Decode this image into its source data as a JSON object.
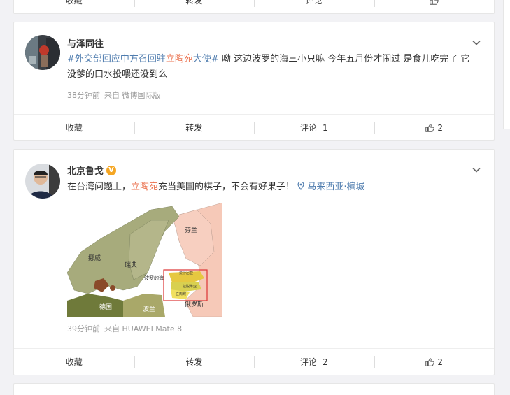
{
  "top_actions": {
    "collect": "收藏",
    "repost": "转发",
    "comment": "评论"
  },
  "post1": {
    "username": "与泽同往",
    "text_topic1": "#外交部回应中方召回驻",
    "text_mention": "立陶宛",
    "text_topic2": "大使#",
    "text_body": " 呦 这边波罗的海三小只嘛 今年五月份才闹过 是食儿吃完了 它没爹的口水投喂还没到么",
    "time": "38分钟前",
    "source": "来自 微博国际版",
    "actions": {
      "collect": "收藏",
      "repost": "转发",
      "comment": "评论",
      "comment_count": "1",
      "like_count": "2"
    }
  },
  "post2": {
    "username": "北京鲁戈",
    "verified_badge": "V",
    "text_pre": "在台湾问题上，",
    "text_mention": "立陶宛",
    "text_post": "充当美国的棋子，不会有好果子！",
    "location": "马来西亚·槟城",
    "map_labels": {
      "norway": "挪威",
      "sweden": "瑞典",
      "finland": "芬兰",
      "baltic": "波罗的海",
      "germany": "德国",
      "poland": "波兰",
      "russia": "俄罗斯",
      "estonia": "爱沙尼亚",
      "latvia": "拉脱维亚",
      "lithuania": "立陶宛"
    },
    "time": "39分钟前",
    "source": "来自 HUAWEI Mate 8",
    "actions": {
      "collect": "收藏",
      "repost": "转发",
      "comment": "评论",
      "comment_count": "2",
      "like_count": "2"
    }
  },
  "colors": {
    "link": "#507daf",
    "mention": "#eb7350",
    "badge": "#f5a623"
  }
}
